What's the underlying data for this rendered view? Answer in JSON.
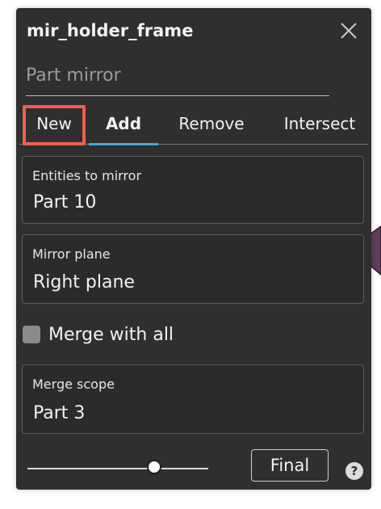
{
  "dialog": {
    "title": "mir_holder_frame",
    "close_icon": "close-icon"
  },
  "name_field": {
    "value": "",
    "placeholder": "Part mirror"
  },
  "tabs": [
    {
      "label": "New",
      "highlighted": true
    },
    {
      "label": "Add",
      "active": true
    },
    {
      "label": "Remove"
    },
    {
      "label": "Intersect"
    }
  ],
  "fields": {
    "entities": {
      "label": "Entities to mirror",
      "value": "Part 10"
    },
    "plane": {
      "label": "Mirror plane",
      "value": "Right plane"
    },
    "merge_scope": {
      "label": "Merge scope",
      "value": "Part 3"
    }
  },
  "merge_with_all": {
    "label": "Merge with all",
    "checked": false
  },
  "rollback_slider": {
    "level": 0.72
  },
  "final_button": {
    "label": "Final"
  },
  "help_icon": "help-icon",
  "colors": {
    "panel_bg": "#2f2f2f",
    "active_tab_underline": "#4ea5d9",
    "highlight_box": "#f0604f"
  }
}
